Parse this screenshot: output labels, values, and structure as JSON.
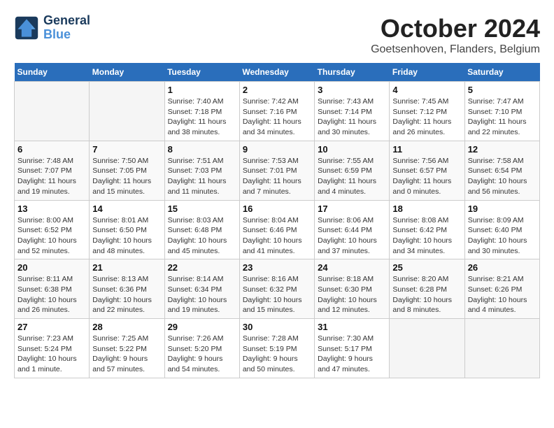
{
  "logo": {
    "line1": "General",
    "line2": "Blue"
  },
  "title": "October 2024",
  "location": "Goetsenhoven, Flanders, Belgium",
  "days_of_week": [
    "Sunday",
    "Monday",
    "Tuesday",
    "Wednesday",
    "Thursday",
    "Friday",
    "Saturday"
  ],
  "weeks": [
    [
      {
        "day": "",
        "info": ""
      },
      {
        "day": "",
        "info": ""
      },
      {
        "day": "1",
        "info": "Sunrise: 7:40 AM\nSunset: 7:18 PM\nDaylight: 11 hours and 38 minutes."
      },
      {
        "day": "2",
        "info": "Sunrise: 7:42 AM\nSunset: 7:16 PM\nDaylight: 11 hours and 34 minutes."
      },
      {
        "day": "3",
        "info": "Sunrise: 7:43 AM\nSunset: 7:14 PM\nDaylight: 11 hours and 30 minutes."
      },
      {
        "day": "4",
        "info": "Sunrise: 7:45 AM\nSunset: 7:12 PM\nDaylight: 11 hours and 26 minutes."
      },
      {
        "day": "5",
        "info": "Sunrise: 7:47 AM\nSunset: 7:10 PM\nDaylight: 11 hours and 22 minutes."
      }
    ],
    [
      {
        "day": "6",
        "info": "Sunrise: 7:48 AM\nSunset: 7:07 PM\nDaylight: 11 hours and 19 minutes."
      },
      {
        "day": "7",
        "info": "Sunrise: 7:50 AM\nSunset: 7:05 PM\nDaylight: 11 hours and 15 minutes."
      },
      {
        "day": "8",
        "info": "Sunrise: 7:51 AM\nSunset: 7:03 PM\nDaylight: 11 hours and 11 minutes."
      },
      {
        "day": "9",
        "info": "Sunrise: 7:53 AM\nSunset: 7:01 PM\nDaylight: 11 hours and 7 minutes."
      },
      {
        "day": "10",
        "info": "Sunrise: 7:55 AM\nSunset: 6:59 PM\nDaylight: 11 hours and 4 minutes."
      },
      {
        "day": "11",
        "info": "Sunrise: 7:56 AM\nSunset: 6:57 PM\nDaylight: 11 hours and 0 minutes."
      },
      {
        "day": "12",
        "info": "Sunrise: 7:58 AM\nSunset: 6:54 PM\nDaylight: 10 hours and 56 minutes."
      }
    ],
    [
      {
        "day": "13",
        "info": "Sunrise: 8:00 AM\nSunset: 6:52 PM\nDaylight: 10 hours and 52 minutes."
      },
      {
        "day": "14",
        "info": "Sunrise: 8:01 AM\nSunset: 6:50 PM\nDaylight: 10 hours and 48 minutes."
      },
      {
        "day": "15",
        "info": "Sunrise: 8:03 AM\nSunset: 6:48 PM\nDaylight: 10 hours and 45 minutes."
      },
      {
        "day": "16",
        "info": "Sunrise: 8:04 AM\nSunset: 6:46 PM\nDaylight: 10 hours and 41 minutes."
      },
      {
        "day": "17",
        "info": "Sunrise: 8:06 AM\nSunset: 6:44 PM\nDaylight: 10 hours and 37 minutes."
      },
      {
        "day": "18",
        "info": "Sunrise: 8:08 AM\nSunset: 6:42 PM\nDaylight: 10 hours and 34 minutes."
      },
      {
        "day": "19",
        "info": "Sunrise: 8:09 AM\nSunset: 6:40 PM\nDaylight: 10 hours and 30 minutes."
      }
    ],
    [
      {
        "day": "20",
        "info": "Sunrise: 8:11 AM\nSunset: 6:38 PM\nDaylight: 10 hours and 26 minutes."
      },
      {
        "day": "21",
        "info": "Sunrise: 8:13 AM\nSunset: 6:36 PM\nDaylight: 10 hours and 22 minutes."
      },
      {
        "day": "22",
        "info": "Sunrise: 8:14 AM\nSunset: 6:34 PM\nDaylight: 10 hours and 19 minutes."
      },
      {
        "day": "23",
        "info": "Sunrise: 8:16 AM\nSunset: 6:32 PM\nDaylight: 10 hours and 15 minutes."
      },
      {
        "day": "24",
        "info": "Sunrise: 8:18 AM\nSunset: 6:30 PM\nDaylight: 10 hours and 12 minutes."
      },
      {
        "day": "25",
        "info": "Sunrise: 8:20 AM\nSunset: 6:28 PM\nDaylight: 10 hours and 8 minutes."
      },
      {
        "day": "26",
        "info": "Sunrise: 8:21 AM\nSunset: 6:26 PM\nDaylight: 10 hours and 4 minutes."
      }
    ],
    [
      {
        "day": "27",
        "info": "Sunrise: 7:23 AM\nSunset: 5:24 PM\nDaylight: 10 hours and 1 minute."
      },
      {
        "day": "28",
        "info": "Sunrise: 7:25 AM\nSunset: 5:22 PM\nDaylight: 9 hours and 57 minutes."
      },
      {
        "day": "29",
        "info": "Sunrise: 7:26 AM\nSunset: 5:20 PM\nDaylight: 9 hours and 54 minutes."
      },
      {
        "day": "30",
        "info": "Sunrise: 7:28 AM\nSunset: 5:19 PM\nDaylight: 9 hours and 50 minutes."
      },
      {
        "day": "31",
        "info": "Sunrise: 7:30 AM\nSunset: 5:17 PM\nDaylight: 9 hours and 47 minutes."
      },
      {
        "day": "",
        "info": ""
      },
      {
        "day": "",
        "info": ""
      }
    ]
  ]
}
